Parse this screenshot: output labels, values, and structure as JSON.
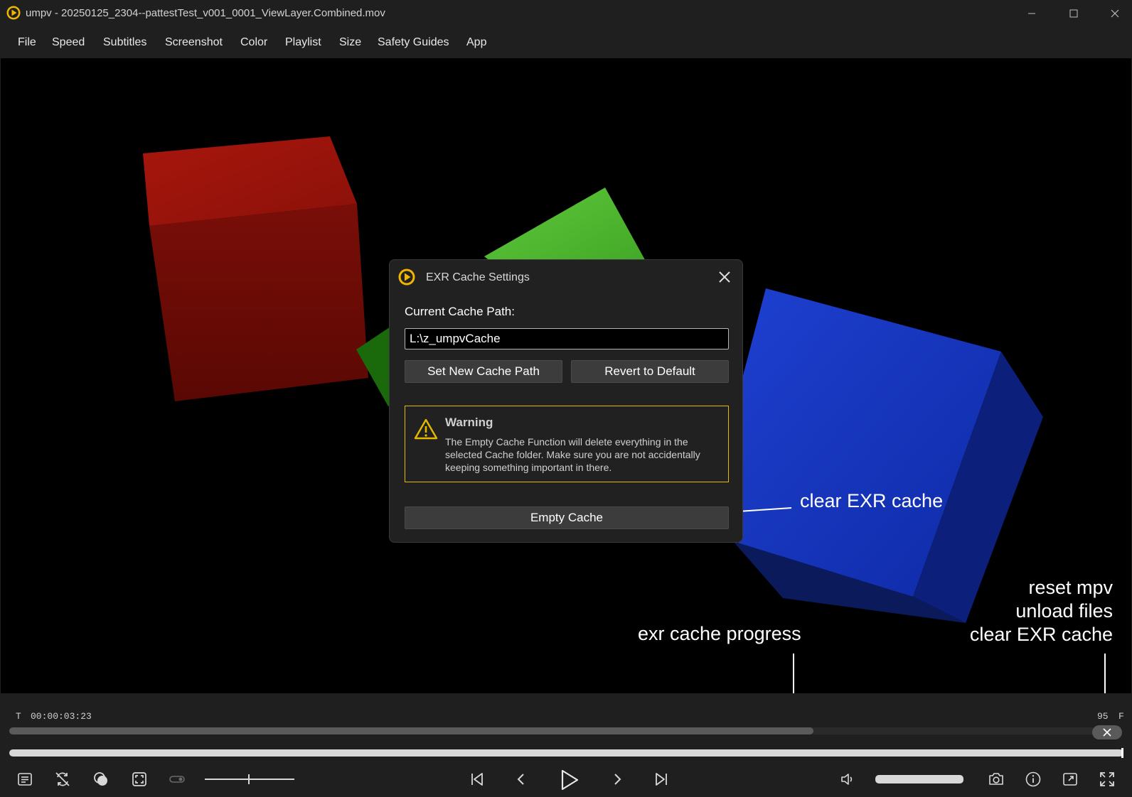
{
  "window": {
    "title": "umpv - 20250125_2304--pattestTest_v001_0001_ViewLayer.Combined.mov",
    "controls": [
      "minimize-icon",
      "maximize-icon",
      "close-icon"
    ]
  },
  "menu": {
    "items": [
      "File",
      "Speed",
      "Subtitles",
      "Screenshot",
      "Color",
      "Playlist",
      "Size",
      "Safety Guides",
      "App"
    ]
  },
  "dialog": {
    "title": "EXR Cache Settings",
    "path_label": "Current Cache Path:",
    "path_value": "L:\\z_umpvCache",
    "set_path_button": "Set New Cache Path",
    "revert_button": "Revert to Default",
    "warning_title": "Warning",
    "warning_text": "The Empty Cache Function will delete everything in the selected Cache folder. Make sure you are not accidentally keeping something important in there.",
    "empty_cache_button": "Empty Cache",
    "accent_color": "#e6b800"
  },
  "annotations": {
    "clear_exr": "clear EXR cache",
    "progress": "exr cache progress",
    "reset_lines": [
      "reset mpv",
      "unload files",
      "clear EXR cache"
    ]
  },
  "playback": {
    "time_prefix": "T",
    "timecode": "00:00:03:23",
    "frame_number": "95",
    "frame_suffix": "F",
    "cache_progress": 0.74,
    "playhead_position": 1.0,
    "volume_level": 1.0
  },
  "toolbar_icons": {
    "left": [
      "playlist-icon",
      "loop-off-icon",
      "color-overlay-icon",
      "safety-guides-icon",
      "toggle-icon"
    ],
    "center": [
      "skip-start-icon",
      "prev-frame-icon",
      "play-icon",
      "next-frame-icon",
      "skip-end-icon"
    ],
    "right": [
      "volume-icon",
      "screenshot-icon",
      "info-icon",
      "resize-icon",
      "fullscreen-icon"
    ]
  }
}
